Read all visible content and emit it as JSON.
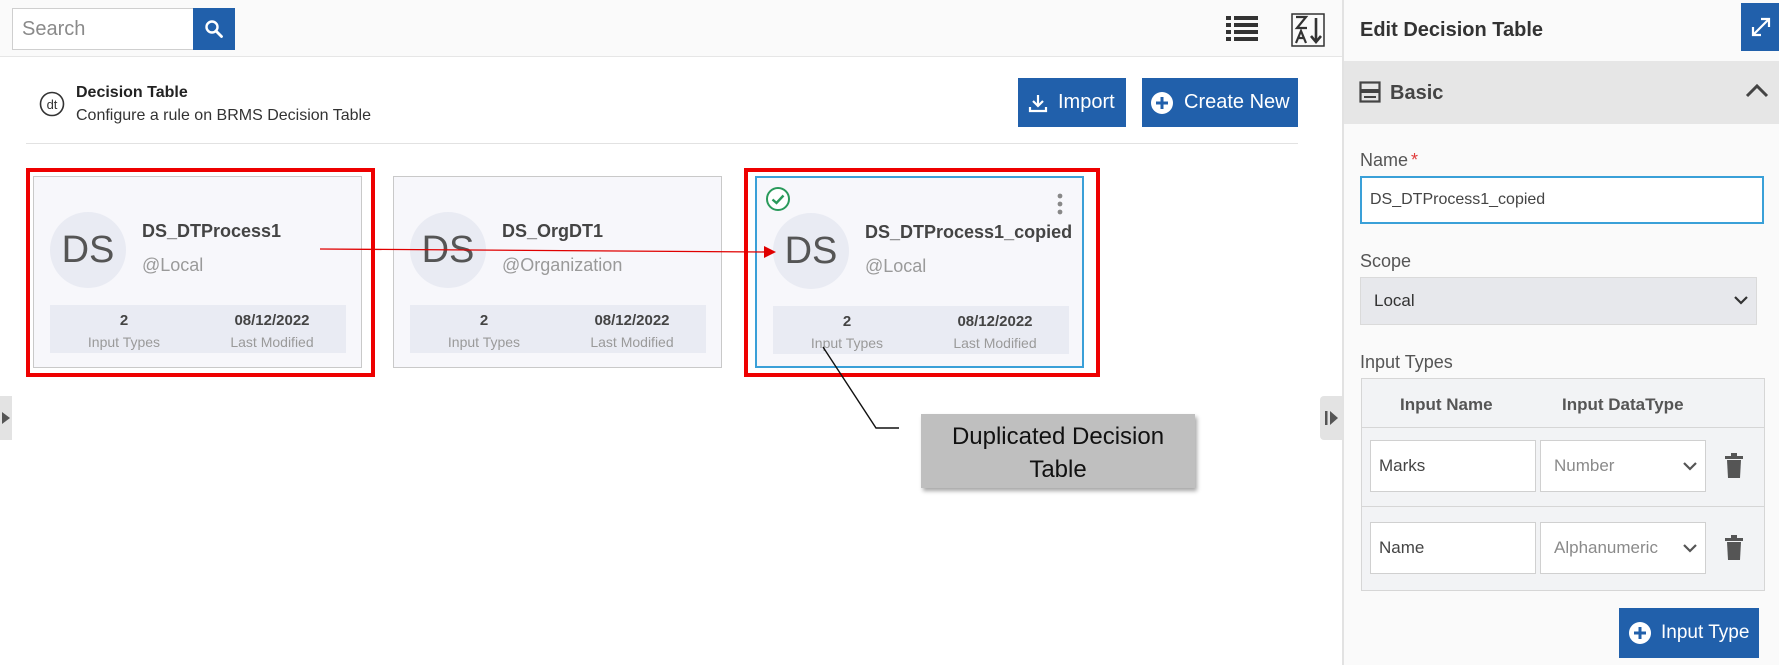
{
  "search": {
    "placeholder": "Search",
    "value": ""
  },
  "toolbar": {
    "list_view_icon": "list-icon",
    "sort_icon": "sort-za-icon"
  },
  "header": {
    "title": "Decision Table",
    "subtitle": "Configure a rule on BRMS Decision Table",
    "import_label": "Import",
    "create_label": "Create New"
  },
  "cards": [
    {
      "initials": "DS",
      "name": "DS_DTProcess1",
      "scope": "@Local",
      "input_types_count": "2",
      "input_types_label": "Input Types",
      "modified": "08/12/2022",
      "modified_label": "Last Modified"
    },
    {
      "initials": "DS",
      "name": "DS_OrgDT1",
      "scope": "@Organization",
      "input_types_count": "2",
      "input_types_label": "Input Types",
      "modified": "08/12/2022",
      "modified_label": "Last Modified"
    },
    {
      "initials": "DS",
      "name": "DS_DTProcess1_copied",
      "scope": "@Local",
      "input_types_count": "2",
      "input_types_label": "Input Types",
      "modified": "08/12/2022",
      "modified_label": "Last Modified"
    }
  ],
  "callout": {
    "line1": "Duplicated Decision",
    "line2": "Table"
  },
  "panel": {
    "title": "Edit Decision Table",
    "section_title": "Basic",
    "name_label": "Name",
    "required_mark": "*",
    "name_value": "DS_DTProcess1_copied",
    "scope_label": "Scope",
    "scope_value": "Local",
    "input_types_label": "Input Types",
    "col_name": "Input Name",
    "col_type": "Input DataType",
    "rows": [
      {
        "name": "Marks",
        "type": "Number"
      },
      {
        "name": "Name",
        "type": "Alphanumeric"
      }
    ],
    "add_button_label": "Input Type"
  },
  "colors": {
    "primary": "#2160ab",
    "highlight": "#ee0000",
    "selected_border": "#3aa0d8",
    "check": "#2a9a5b"
  }
}
